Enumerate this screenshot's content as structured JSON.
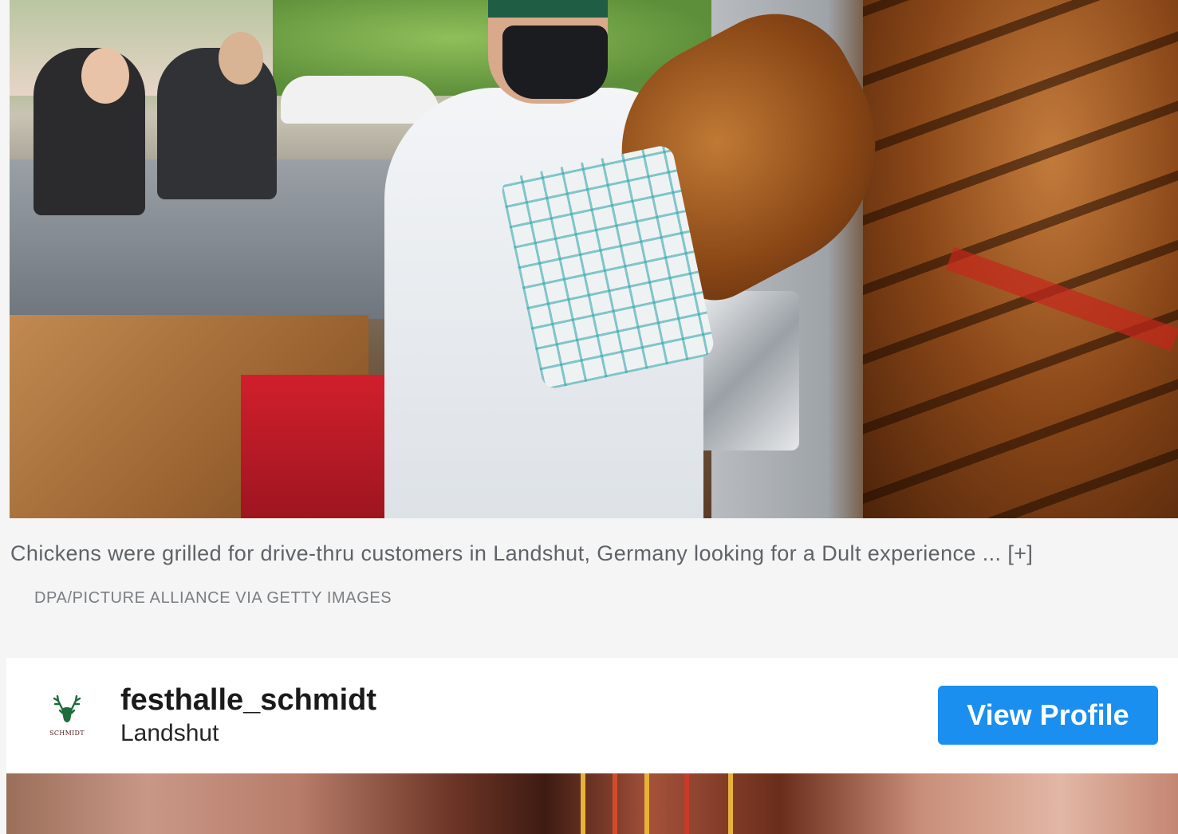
{
  "photo": {
    "alt_subject": "chef-with-rotisserie-chickens"
  },
  "caption": {
    "text": "Chickens were grilled for drive-thru customers in Landshut, Germany looking for a Dult experience ...",
    "more": "[+]",
    "credit": "DPA/PICTURE ALLIANCE VIA GETTY IMAGES"
  },
  "embed": {
    "logo_icon": "stag-head-icon",
    "logo_text": "SCHMIDT",
    "username": "festhalle_schmidt",
    "location": "Landshut",
    "button_label": "View Profile",
    "button_color": "#1a8ff0"
  }
}
